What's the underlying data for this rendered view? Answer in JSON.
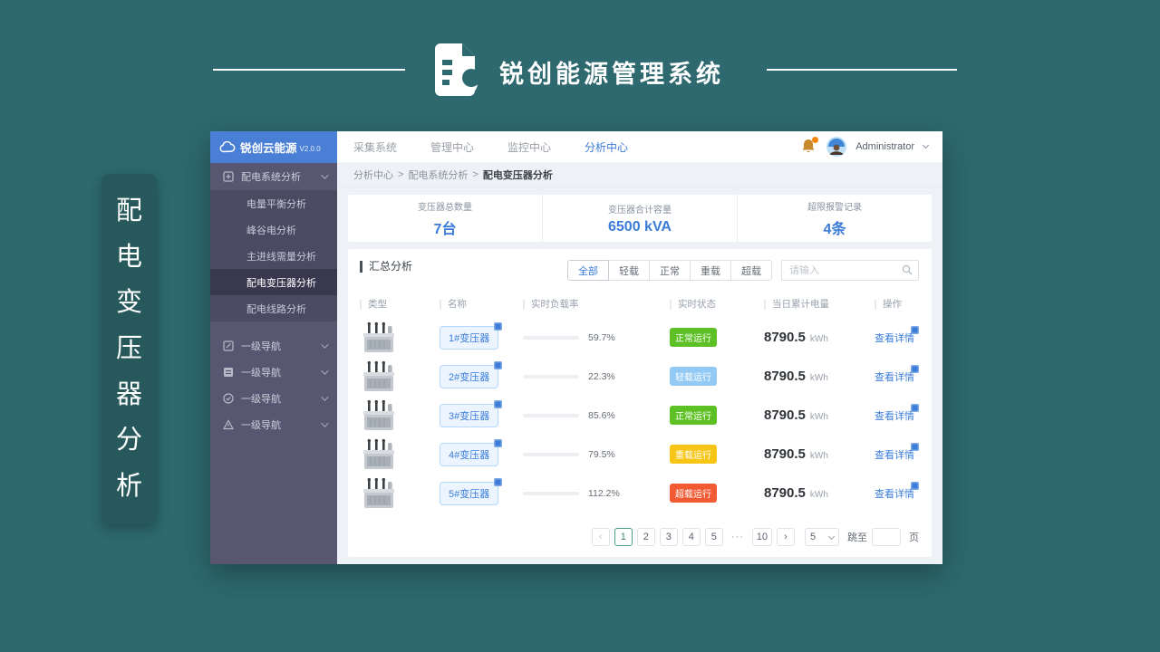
{
  "banner": {
    "title": "锐创能源管理系统"
  },
  "side_tag": {
    "text": "配电变压器分析",
    "chars": [
      "配",
      "电",
      "变",
      "压",
      "器",
      "分",
      "析"
    ]
  },
  "app": {
    "logo": {
      "name": "锐创云能源",
      "version": "V2.0.0"
    },
    "topnav": {
      "items": [
        {
          "label": "采集系统"
        },
        {
          "label": "管理中心"
        },
        {
          "label": "监控中心"
        },
        {
          "label": "分析中心"
        }
      ],
      "active": "分析中心",
      "user": {
        "name": "Administrator"
      }
    },
    "sidebar": {
      "groups": [
        {
          "label": "配电系统分析",
          "icon": "grid-icon"
        },
        {
          "label": "一级导航",
          "icon": "edit-icon"
        },
        {
          "label": "一级导航",
          "icon": "list-icon"
        },
        {
          "label": "一级导航",
          "icon": "check-circle-icon"
        },
        {
          "label": "一级导航",
          "icon": "warning-icon"
        }
      ],
      "children": [
        {
          "label": "电量平衡分析"
        },
        {
          "label": "峰谷电分析"
        },
        {
          "label": "主进线需量分析"
        },
        {
          "label": "配电变压器分析"
        },
        {
          "label": "配电线路分析"
        }
      ],
      "active_child": "配电变压器分析"
    },
    "breadcrumb": {
      "sep": ">",
      "parts": [
        "分析中心",
        "配电系统分析",
        "配电变压器分析"
      ]
    },
    "stats": [
      {
        "label": "变压器总数量",
        "value": "7台"
      },
      {
        "label": "变压器合计容量",
        "value": "6500 kVA"
      },
      {
        "label": "超限报警记录",
        "value": "4条"
      }
    ],
    "summary": {
      "title": "汇总分析",
      "filters": [
        {
          "label": "全部",
          "active": true
        },
        {
          "label": "轻载",
          "active": false
        },
        {
          "label": "正常",
          "active": false
        },
        {
          "label": "重载",
          "active": false
        },
        {
          "label": "超载",
          "active": false
        }
      ],
      "search_placeholder": "请输入"
    },
    "table": {
      "columns": [
        "类型",
        "名称",
        "实时负载率",
        "实时状态",
        "当日累计电量",
        "操作"
      ],
      "energy_unit": "kWh",
      "action_label": "查看详情",
      "load_scale_max": 120,
      "rows": [
        {
          "name": "1#变压器",
          "load_label": "59.7%",
          "load_pct": 59.7,
          "status": "正常运行",
          "status_type": "normal",
          "energy": "8790.5"
        },
        {
          "name": "2#变压器",
          "load_label": "22.3%",
          "load_pct": 22.3,
          "status": "轻载运行",
          "status_type": "light",
          "energy": "8790.5"
        },
        {
          "name": "3#变压器",
          "load_label": "85.6%",
          "load_pct": 85.6,
          "status": "正常运行",
          "status_type": "normal",
          "energy": "8790.5"
        },
        {
          "name": "4#变压器",
          "load_label": "79.5%",
          "load_pct": 79.5,
          "status": "重载运行",
          "status_type": "heavy",
          "energy": "8790.5"
        },
        {
          "name": "5#变压器",
          "load_label": "112.2%",
          "load_pct": 112.2,
          "status": "超载运行",
          "status_type": "over",
          "energy": "8790.5"
        }
      ]
    },
    "pagination": {
      "prev": "‹",
      "next": "›",
      "pages": [
        "1",
        "2",
        "3",
        "4",
        "5",
        "···",
        "10"
      ],
      "active_page": "1",
      "page_size": "5",
      "jump_label": "跳至",
      "page_label": "页"
    }
  },
  "colors": {
    "page_teal": "#2d696e",
    "tag_teal": "#26585c",
    "accent_blue": "#3a7cd8",
    "logo_blue": "#4a7fd6",
    "sidebar_bg": "#585670",
    "status_normal": "#5dc024",
    "status_light": "#92c9f5",
    "status_heavy": "#f7c516",
    "status_over": "#f25a33",
    "pager_active": "#4ba08a",
    "notify_orange": "#f5850e"
  }
}
